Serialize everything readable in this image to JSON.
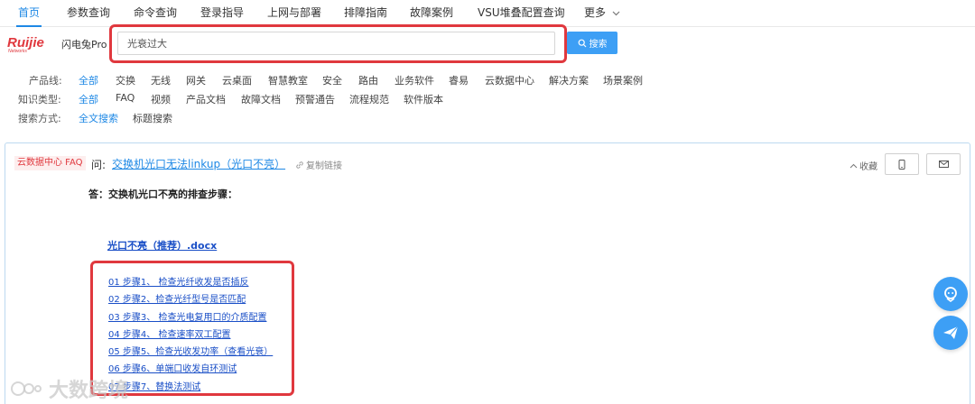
{
  "nav": {
    "items": [
      "首页",
      "参数查询",
      "命令查询",
      "登录指导",
      "上网与部署",
      "排障指南",
      "故障案例",
      "VSU堆叠配置查询",
      "更多"
    ]
  },
  "brand": {
    "logo_text": "Ruijie",
    "logo_sub": "Networks",
    "product": "闪电兔Pro",
    "logo_color": "#e0383e"
  },
  "search": {
    "value": "光衰过大",
    "button_label": "搜索"
  },
  "filters": {
    "product_line": {
      "label": "产品线:",
      "options": [
        "全部",
        "交换",
        "无线",
        "网关",
        "云桌面",
        "智慧教室",
        "安全",
        "路由",
        "业务软件",
        "睿易",
        "云数据中心",
        "解决方案",
        "场景案例"
      ]
    },
    "knowledge_type": {
      "label": "知识类型:",
      "options": [
        "全部",
        "FAQ",
        "视频",
        "产品文档",
        "故障文档",
        "预警通告",
        "流程规范",
        "软件版本"
      ]
    },
    "search_mode": {
      "label": "搜索方式:",
      "options": [
        "全文搜索",
        "标题搜索"
      ]
    }
  },
  "result": {
    "tag": "云数据中心 FAQ",
    "question_prefix": "问:",
    "title": "交换机光口无法linkup（光口不亮）",
    "copy_label": "复制链接",
    "collect_label": "收藏",
    "answer": "答：交换机光口不亮的排查步骤：",
    "doc_link": "光口不亮（推荐）.docx",
    "steps": [
      "01 步骤1、 检查光纤收发是否插反",
      "02 步骤2、检查光纤型号是否匹配",
      "03 步骤3、 检查光电复用口的介质配置",
      "04 步骤4、 检查速率双工配置",
      "05 步骤5、检查光收发功率（查看光衰）",
      "06 步骤6、单端口收发自环测试",
      "07 步骤7、替换法测试"
    ]
  },
  "watermark": "大数跨境",
  "colors": {
    "accent": "#1e88e5",
    "button": "#3d9ff5",
    "highlight": "#e0383e",
    "link": "#1a4fc7"
  }
}
